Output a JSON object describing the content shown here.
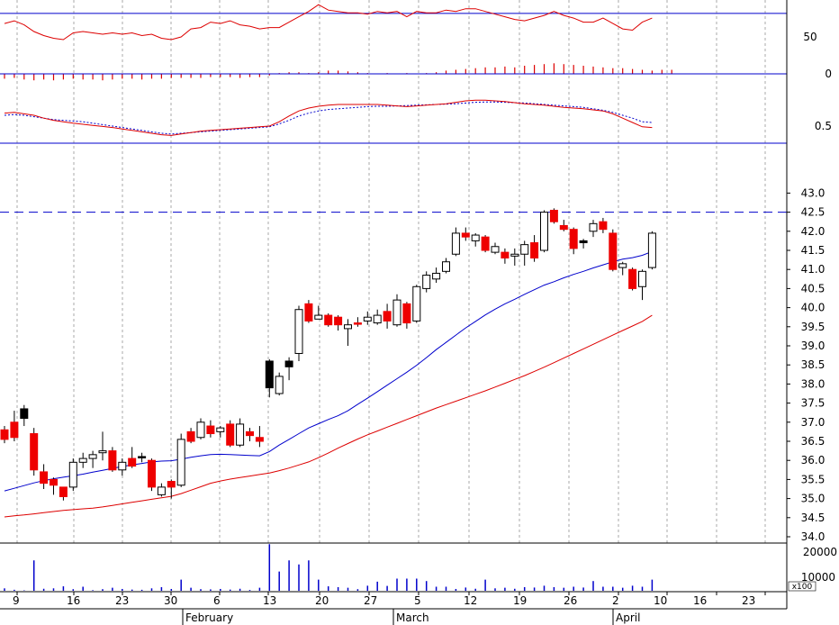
{
  "chart_data": {
    "type": "stock-chart",
    "colors": {
      "up": "#ffffff",
      "down": "#ee0000",
      "special": "#000000",
      "ma_short": "#0000cc",
      "ma_long": "#dd0000",
      "grid": "#aaaaaa",
      "frame": "#000000",
      "ref_line": "#0000cc",
      "volume": "#0000cc"
    },
    "x_axis": {
      "day_ticks": [
        "9",
        "16",
        "23",
        "30",
        "6",
        "13",
        "20",
        "27",
        "5",
        "12",
        "19",
        "26",
        "2",
        "10",
        "16",
        "23"
      ],
      "months": [
        "February",
        "March",
        "April"
      ],
      "grid": true
    },
    "price_panel": {
      "ylim": [
        33.85,
        43.35
      ],
      "yticks": [
        "34.0",
        "34.5",
        "35.0",
        "35.5",
        "36.0",
        "36.5",
        "37.0",
        "37.5",
        "38.0",
        "38.5",
        "39.0",
        "39.5",
        "40.0",
        "40.5",
        "41.0",
        "41.5",
        "42.0",
        "42.5",
        "43.0"
      ],
      "resistance": 42.5,
      "candles": [
        {
          "o": 36.55,
          "h": 36.9,
          "l": 36.45,
          "c": 36.8,
          "col": "down"
        },
        {
          "o": 37.0,
          "h": 37.3,
          "l": 36.5,
          "c": 36.6,
          "col": "down"
        },
        {
          "o": 37.1,
          "h": 37.45,
          "l": 36.9,
          "c": 37.35,
          "col": "special"
        },
        {
          "o": 36.7,
          "h": 36.85,
          "l": 35.6,
          "c": 35.75,
          "col": "down"
        },
        {
          "o": 35.7,
          "h": 35.9,
          "l": 35.25,
          "c": 35.4,
          "col": "down"
        },
        {
          "o": 35.5,
          "h": 35.55,
          "l": 35.1,
          "c": 35.35,
          "col": "down"
        },
        {
          "o": 35.3,
          "h": 35.3,
          "l": 34.95,
          "c": 35.05,
          "col": "down"
        },
        {
          "o": 35.3,
          "h": 36.05,
          "l": 35.2,
          "c": 35.95,
          "col": "up"
        },
        {
          "o": 35.95,
          "h": 36.2,
          "l": 35.8,
          "c": 36.05,
          "col": "up"
        },
        {
          "o": 36.05,
          "h": 36.25,
          "l": 35.8,
          "c": 36.15,
          "col": "up"
        },
        {
          "o": 36.2,
          "h": 36.75,
          "l": 36.0,
          "c": 36.25,
          "col": "up"
        },
        {
          "o": 36.25,
          "h": 36.35,
          "l": 35.7,
          "c": 35.75,
          "col": "down"
        },
        {
          "o": 35.75,
          "h": 36.05,
          "l": 35.6,
          "c": 35.95,
          "col": "up"
        },
        {
          "o": 36.05,
          "h": 36.35,
          "l": 35.8,
          "c": 35.85,
          "col": "down"
        },
        {
          "o": 36.1,
          "h": 36.2,
          "l": 35.95,
          "c": 36.1,
          "col": "special"
        },
        {
          "o": 36.0,
          "h": 36.05,
          "l": 35.2,
          "c": 35.3,
          "col": "down"
        },
        {
          "o": 35.1,
          "h": 35.4,
          "l": 35.05,
          "c": 35.3,
          "col": "up"
        },
        {
          "o": 35.45,
          "h": 35.5,
          "l": 35.0,
          "c": 35.3,
          "col": "down"
        },
        {
          "o": 35.35,
          "h": 36.7,
          "l": 35.3,
          "c": 36.55,
          "col": "up"
        },
        {
          "o": 36.75,
          "h": 36.85,
          "l": 36.45,
          "c": 36.5,
          "col": "down"
        },
        {
          "o": 36.6,
          "h": 37.1,
          "l": 36.55,
          "c": 37.0,
          "col": "up"
        },
        {
          "o": 36.9,
          "h": 37.05,
          "l": 36.6,
          "c": 36.7,
          "col": "down"
        },
        {
          "o": 36.75,
          "h": 36.9,
          "l": 36.6,
          "c": 36.85,
          "col": "up"
        },
        {
          "o": 36.95,
          "h": 37.05,
          "l": 36.35,
          "c": 36.4,
          "col": "down"
        },
        {
          "o": 36.4,
          "h": 37.1,
          "l": 36.35,
          "c": 36.95,
          "col": "up"
        },
        {
          "o": 36.75,
          "h": 36.85,
          "l": 36.5,
          "c": 36.65,
          "col": "down"
        },
        {
          "o": 36.5,
          "h": 36.9,
          "l": 36.35,
          "c": 36.6,
          "col": "down"
        },
        {
          "o": 38.6,
          "h": 38.65,
          "l": 37.65,
          "c": 37.9,
          "col": "special"
        },
        {
          "o": 37.75,
          "h": 38.3,
          "l": 37.7,
          "c": 38.2,
          "col": "up"
        },
        {
          "o": 38.45,
          "h": 38.7,
          "l": 38.1,
          "c": 38.6,
          "col": "special"
        },
        {
          "o": 38.8,
          "h": 40.05,
          "l": 38.6,
          "c": 39.95,
          "col": "up"
        },
        {
          "o": 40.1,
          "h": 40.2,
          "l": 39.6,
          "c": 39.65,
          "col": "down"
        },
        {
          "o": 39.7,
          "h": 40.05,
          "l": 39.7,
          "c": 39.8,
          "col": "up"
        },
        {
          "o": 39.8,
          "h": 39.85,
          "l": 39.5,
          "c": 39.55,
          "col": "down"
        },
        {
          "o": 39.75,
          "h": 39.8,
          "l": 39.4,
          "c": 39.55,
          "col": "down"
        },
        {
          "o": 39.45,
          "h": 39.7,
          "l": 39.0,
          "c": 39.55,
          "col": "up"
        },
        {
          "o": 39.6,
          "h": 39.75,
          "l": 39.5,
          "c": 39.6,
          "col": "down"
        },
        {
          "o": 39.65,
          "h": 39.9,
          "l": 39.55,
          "c": 39.75,
          "col": "up"
        },
        {
          "o": 39.6,
          "h": 39.95,
          "l": 39.55,
          "c": 39.8,
          "col": "up"
        },
        {
          "o": 39.9,
          "h": 40.1,
          "l": 39.45,
          "c": 39.65,
          "col": "down"
        },
        {
          "o": 39.55,
          "h": 40.35,
          "l": 39.5,
          "c": 40.2,
          "col": "up"
        },
        {
          "o": 40.1,
          "h": 40.15,
          "l": 39.45,
          "c": 39.6,
          "col": "down"
        },
        {
          "o": 39.65,
          "h": 40.6,
          "l": 39.6,
          "c": 40.55,
          "col": "up"
        },
        {
          "o": 40.5,
          "h": 40.95,
          "l": 40.4,
          "c": 40.85,
          "col": "up"
        },
        {
          "o": 40.75,
          "h": 41.05,
          "l": 40.65,
          "c": 40.9,
          "col": "up"
        },
        {
          "o": 40.95,
          "h": 41.3,
          "l": 40.9,
          "c": 41.2,
          "col": "up"
        },
        {
          "o": 41.4,
          "h": 42.1,
          "l": 41.35,
          "c": 41.95,
          "col": "up"
        },
        {
          "o": 41.95,
          "h": 42.1,
          "l": 41.75,
          "c": 41.85,
          "col": "down"
        },
        {
          "o": 41.75,
          "h": 41.95,
          "l": 41.6,
          "c": 41.9,
          "col": "up"
        },
        {
          "o": 41.85,
          "h": 41.9,
          "l": 41.45,
          "c": 41.5,
          "col": "down"
        },
        {
          "o": 41.45,
          "h": 41.7,
          "l": 41.4,
          "c": 41.6,
          "col": "up"
        },
        {
          "o": 41.45,
          "h": 41.55,
          "l": 41.15,
          "c": 41.3,
          "col": "down"
        },
        {
          "o": 41.35,
          "h": 41.55,
          "l": 41.1,
          "c": 41.4,
          "col": "up"
        },
        {
          "o": 41.4,
          "h": 41.75,
          "l": 41.1,
          "c": 41.65,
          "col": "up"
        },
        {
          "o": 41.7,
          "h": 41.9,
          "l": 41.2,
          "c": 41.3,
          "col": "down"
        },
        {
          "o": 41.5,
          "h": 42.55,
          "l": 41.45,
          "c": 42.5,
          "col": "up"
        },
        {
          "o": 42.55,
          "h": 42.6,
          "l": 42.2,
          "c": 42.25,
          "col": "down"
        },
        {
          "o": 42.15,
          "h": 42.3,
          "l": 42.0,
          "c": 42.05,
          "col": "down"
        },
        {
          "o": 42.05,
          "h": 42.1,
          "l": 41.4,
          "c": 41.55,
          "col": "down"
        },
        {
          "o": 41.75,
          "h": 41.8,
          "l": 41.55,
          "c": 41.7,
          "col": "special"
        },
        {
          "o": 42.0,
          "h": 42.3,
          "l": 41.85,
          "c": 42.2,
          "col": "up"
        },
        {
          "o": 42.25,
          "h": 42.35,
          "l": 41.95,
          "c": 42.05,
          "col": "down"
        },
        {
          "o": 41.95,
          "h": 42.05,
          "l": 40.95,
          "c": 41.0,
          "col": "down"
        },
        {
          "o": 41.05,
          "h": 41.2,
          "l": 40.85,
          "c": 41.15,
          "col": "up"
        },
        {
          "o": 41.0,
          "h": 41.05,
          "l": 40.45,
          "c": 40.5,
          "col": "down"
        },
        {
          "o": 40.55,
          "h": 41.0,
          "l": 40.2,
          "c": 40.95,
          "col": "up"
        },
        {
          "o": 41.05,
          "h": 42.0,
          "l": 41.0,
          "c": 41.95,
          "col": "up"
        }
      ],
      "ma_short": [
        35.2,
        35.27,
        35.34,
        35.41,
        35.47,
        35.52,
        35.56,
        35.6,
        35.64,
        35.69,
        35.74,
        35.79,
        35.84,
        35.88,
        35.92,
        35.96,
        35.98,
        35.99,
        36.03,
        36.08,
        36.12,
        36.15,
        36.16,
        36.15,
        36.14,
        36.13,
        36.12,
        36.23,
        36.4,
        36.55,
        36.7,
        36.85,
        36.96,
        37.07,
        37.17,
        37.3,
        37.47,
        37.63,
        37.8,
        37.97,
        38.14,
        38.31,
        38.49,
        38.69,
        38.9,
        39.09,
        39.28,
        39.47,
        39.64,
        39.81,
        39.96,
        40.1,
        40.22,
        40.35,
        40.47,
        40.59,
        40.68,
        40.78,
        40.87,
        40.95,
        41.04,
        41.12,
        41.2,
        41.27,
        41.31,
        41.37,
        41.47
      ],
      "ma_long": [
        34.52,
        34.55,
        34.57,
        34.6,
        34.63,
        34.66,
        34.69,
        34.71,
        34.73,
        34.75,
        34.78,
        34.82,
        34.86,
        34.9,
        34.94,
        34.98,
        35.02,
        35.06,
        35.13,
        35.22,
        35.31,
        35.4,
        35.46,
        35.51,
        35.55,
        35.59,
        35.63,
        35.67,
        35.73,
        35.8,
        35.88,
        35.96,
        36.07,
        36.19,
        36.32,
        36.44,
        36.56,
        36.67,
        36.77,
        36.87,
        36.97,
        37.07,
        37.17,
        37.27,
        37.37,
        37.46,
        37.55,
        37.64,
        37.73,
        37.82,
        37.92,
        38.02,
        38.12,
        38.22,
        38.33,
        38.44,
        38.56,
        38.68,
        38.8,
        38.92,
        39.04,
        39.16,
        39.28,
        39.4,
        39.52,
        39.64,
        39.8
      ]
    },
    "volume_panel": {
      "yticks": [
        "20000",
        "10000"
      ],
      "unit": "x100",
      "values": [
        1200,
        500,
        200,
        15000,
        1000,
        1200,
        2200,
        800,
        2000,
        300,
        800,
        1500,
        900,
        600,
        500,
        1200,
        1800,
        900,
        5500,
        1500,
        800,
        700,
        900,
        600,
        1000,
        400,
        1500,
        23000,
        9500,
        15000,
        13000,
        15000,
        5500,
        2200,
        1800,
        1500,
        800,
        2500,
        4500,
        2400,
        6000,
        6000,
        6000,
        4800,
        2000,
        2000,
        900,
        1600,
        1000,
        5500,
        1200,
        1500,
        1000,
        1800,
        1600,
        2500,
        1800,
        1500,
        2000,
        1600,
        4800,
        2000,
        2000,
        1500,
        2500,
        2000,
        5500
      ]
    },
    "indicator_panel": {
      "yticks": [
        "0.5"
      ],
      "line": [
        0.86,
        0.88,
        0.84,
        0.8,
        0.72,
        0.66,
        0.62,
        0.58,
        0.55,
        0.52,
        0.49,
        0.46,
        0.42,
        0.38,
        0.34,
        0.3,
        0.26,
        0.24,
        0.28,
        0.32,
        0.36,
        0.38,
        0.4,
        0.42,
        0.44,
        0.46,
        0.48,
        0.5,
        0.62,
        0.78,
        0.92,
        1.0,
        1.05,
        1.08,
        1.1,
        1.1,
        1.1,
        1.1,
        1.1,
        1.08,
        1.06,
        1.04,
        1.06,
        1.08,
        1.1,
        1.12,
        1.16,
        1.2,
        1.22,
        1.22,
        1.2,
        1.18,
        1.15,
        1.12,
        1.1,
        1.08,
        1.05,
        1.02,
        1.0,
        0.98,
        0.95,
        0.92,
        0.84,
        0.72,
        0.6,
        0.48,
        0.46
      ],
      "signal": [
        0.8,
        0.82,
        0.8,
        0.76,
        0.72,
        0.68,
        0.66,
        0.64,
        0.62,
        0.58,
        0.54,
        0.5,
        0.46,
        0.42,
        0.38,
        0.34,
        0.3,
        0.28,
        0.3,
        0.32,
        0.34,
        0.36,
        0.38,
        0.4,
        0.42,
        0.44,
        0.46,
        0.48,
        0.56,
        0.66,
        0.78,
        0.86,
        0.92,
        0.96,
        0.98,
        1.0,
        1.02,
        1.04,
        1.05,
        1.05,
        1.06,
        1.07,
        1.08,
        1.09,
        1.1,
        1.11,
        1.12,
        1.14,
        1.16,
        1.17,
        1.17,
        1.16,
        1.15,
        1.14,
        1.12,
        1.1,
        1.08,
        1.06,
        1.04,
        1.02,
        0.98,
        0.94,
        0.88,
        0.8,
        0.72,
        0.62,
        0.6
      ],
      "divider": 0.0
    },
    "hist_panel": {
      "yticks": [
        "0"
      ],
      "values": [
        -6,
        -5,
        -7,
        -8,
        -7,
        -8,
        -7,
        -6,
        -7,
        -7,
        -8,
        -7,
        -6,
        -6,
        -7,
        -6,
        -6,
        -5,
        -5,
        -5,
        -5,
        -4,
        -4,
        -4,
        -5,
        -4,
        -4,
        -2,
        1,
        2,
        2,
        1,
        2,
        4,
        4,
        3,
        2,
        1,
        0,
        1,
        0,
        1,
        0,
        1,
        2,
        4,
        5,
        6,
        7,
        8,
        8,
        9,
        8,
        10,
        11,
        12,
        13,
        12,
        11,
        10,
        9,
        8,
        7,
        7,
        6,
        5,
        4,
        5,
        5
      ],
      "ylim": [
        -15,
        30
      ]
    },
    "oscillator_panel": {
      "yticks": [
        "50"
      ],
      "ylim": [
        -5,
        105
      ],
      "ref_level": 85,
      "values": [
        70,
        74,
        68,
        58,
        52,
        48,
        46,
        56,
        58,
        56,
        54,
        56,
        54,
        56,
        52,
        54,
        48,
        46,
        50,
        62,
        64,
        72,
        70,
        74,
        68,
        66,
        62,
        64,
        64,
        72,
        80,
        88,
        98,
        90,
        88,
        86,
        86,
        84,
        88,
        86,
        88,
        80,
        88,
        86,
        86,
        90,
        88,
        92,
        92,
        88,
        84,
        80,
        76,
        74,
        78,
        82,
        88,
        82,
        78,
        72,
        72,
        78,
        70,
        62,
        60,
        72,
        78
      ]
    }
  }
}
